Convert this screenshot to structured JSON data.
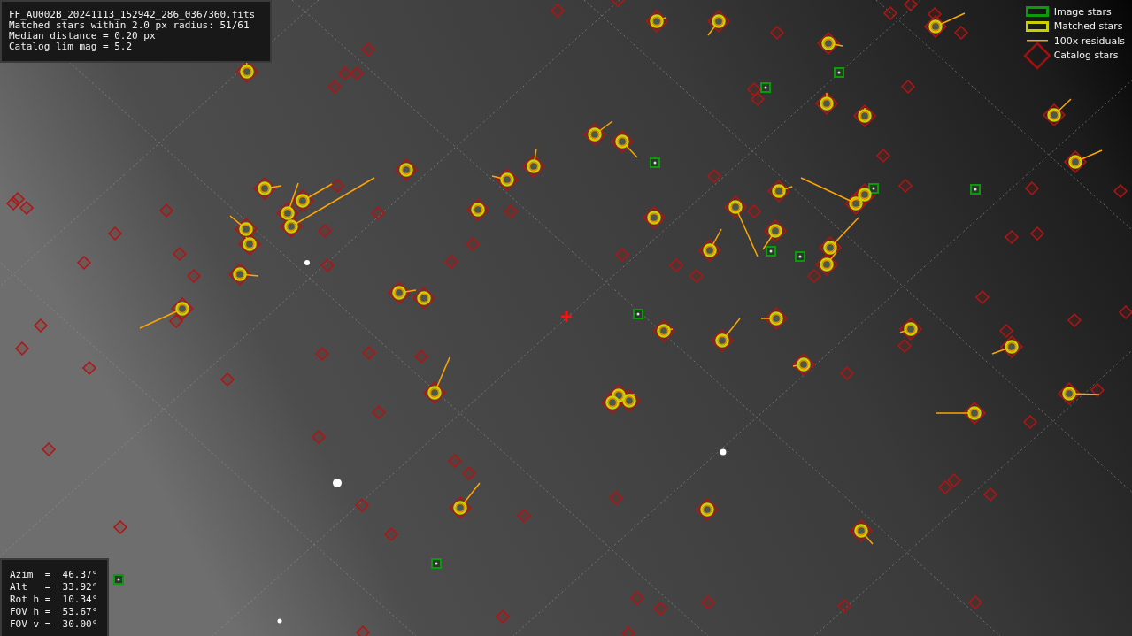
{
  "info_panel": {
    "lines": [
      "FF_AU002B_20241113_152942_286_0367360.fits",
      "Matched stars within 2.0 px radius: 51/61",
      "Median distance = 0.20 px",
      "Catalog lim mag = 5.2"
    ]
  },
  "legend": [
    {
      "kind": "image",
      "label": "Image stars"
    },
    {
      "kind": "matched",
      "label": "Matched stars"
    },
    {
      "kind": "residual",
      "label": "100x residuals"
    },
    {
      "kind": "catalog",
      "label": "Catalog stars"
    }
  ],
  "pointing_panel": {
    "lines": [
      "Azim  =  46.37°",
      "Alt   =  33.92°",
      "Rot h =  10.34°",
      "FOV h =  53.67°",
      "FOV v =  30.00°"
    ]
  }
}
